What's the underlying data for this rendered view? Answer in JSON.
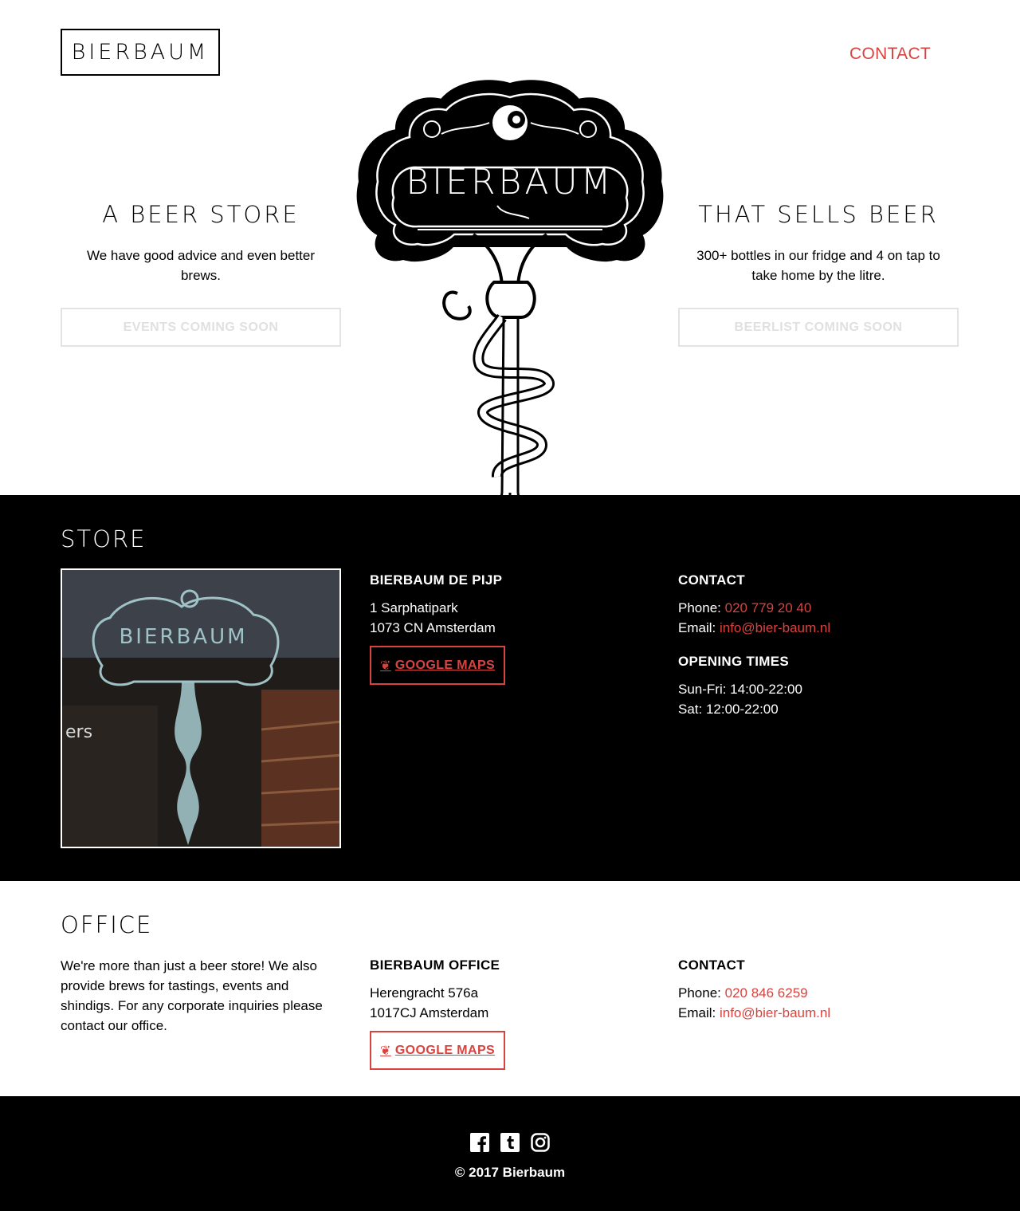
{
  "header": {
    "logo_text": "BIERBAUM",
    "nav_contact": "CONTACT",
    "brand_color": "#d9433f"
  },
  "hero": {
    "left": {
      "title": "A BEER STORE",
      "text": "We have good advice and even better brews.",
      "button": "EVENTS COMING SOON"
    },
    "right": {
      "title": "THAT SELLS BEER",
      "text": "300+ bottles in our fridge and 4 on tap to take home by the litre.",
      "button": "BEERLIST COMING SOON"
    },
    "emblem_text": "BIERBAUM"
  },
  "store": {
    "title": "STORE",
    "photo_sign_text": "BIERBAUM",
    "photo_side_text": "ers",
    "location": {
      "heading": "BIERBAUM DE PIJP",
      "address1": "1 Sarphatipark",
      "address2": "1073 CN Amsterdam",
      "maps_button": "GOOGLE MAPS"
    },
    "contact": {
      "heading": "CONTACT",
      "phone_label": "Phone:",
      "phone": "020 779 20 40",
      "email_label": "Email:",
      "email": "info@bier-baum.nl"
    },
    "hours": {
      "heading": "OPENING TIMES",
      "line1": "Sun-Fri: 14:00-22:00",
      "line2": "Sat: 12:00-22:00"
    }
  },
  "office": {
    "title": "OFFICE",
    "text": "We're more than just a beer store! We also provide brews for tastings, events and shindigs. For any corporate inquiries please contact our office.",
    "location": {
      "heading": "BIERBAUM OFFICE",
      "address1": "Herengracht 576a",
      "address2": "1017CJ Amsterdam",
      "maps_button": "GOOGLE MAPS"
    },
    "contact": {
      "heading": "CONTACT",
      "phone_label": "Phone:",
      "phone": "020 846 6259",
      "email_label": "Email:",
      "email": "info@bier-baum.nl"
    }
  },
  "footer": {
    "socials": [
      "facebook-icon",
      "tumblr-icon",
      "instagram-icon"
    ],
    "copyright": "© 2017 Bierbaum"
  }
}
